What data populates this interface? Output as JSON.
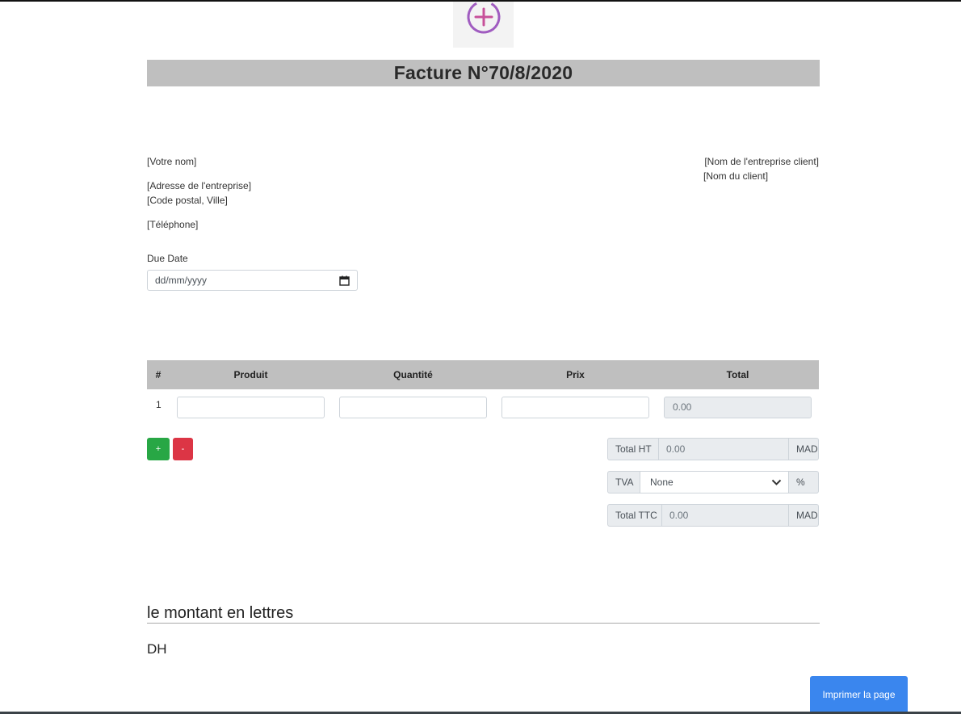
{
  "invoice": {
    "title": "Facture N°70/8/2020"
  },
  "sender": {
    "name": "[Votre nom]",
    "address": "[Adresse de l'entreprise]",
    "postal_city": "[Code postal, Ville]",
    "phone": "[Téléphone]"
  },
  "client": {
    "company": "[Nom de l'entreprise client]",
    "name": "[Nom du client]"
  },
  "due_date": {
    "label": "Due Date",
    "placeholder": "dd/mm/yyyy",
    "icon": "calendar-icon"
  },
  "table": {
    "headers": [
      "#",
      "Produit",
      "Quantité",
      "Prix",
      "Total"
    ],
    "rows": [
      {
        "num": "1",
        "produit": "",
        "quantite": "",
        "prix": "",
        "total": "0.00"
      }
    ]
  },
  "row_buttons": {
    "add": "+",
    "remove": "-"
  },
  "totals": {
    "ht_label": "Total HT",
    "ht_value": "0.00",
    "ht_currency": "MAD",
    "tva_label": "TVA",
    "tva_selected": "None",
    "tva_unit": "%",
    "ttc_label": "Total TTC",
    "ttc_value": "0.00",
    "ttc_currency": "MAD"
  },
  "amount_words": {
    "title": "le montant en lettres",
    "value": "DH"
  },
  "print_button": "Imprimer la page",
  "colors": {
    "header_bg": "#bfbfbf",
    "add_button": "#28a745",
    "remove_button": "#dc3545",
    "print_button": "#3a86ee",
    "logo_accent": "#a05cc0"
  }
}
